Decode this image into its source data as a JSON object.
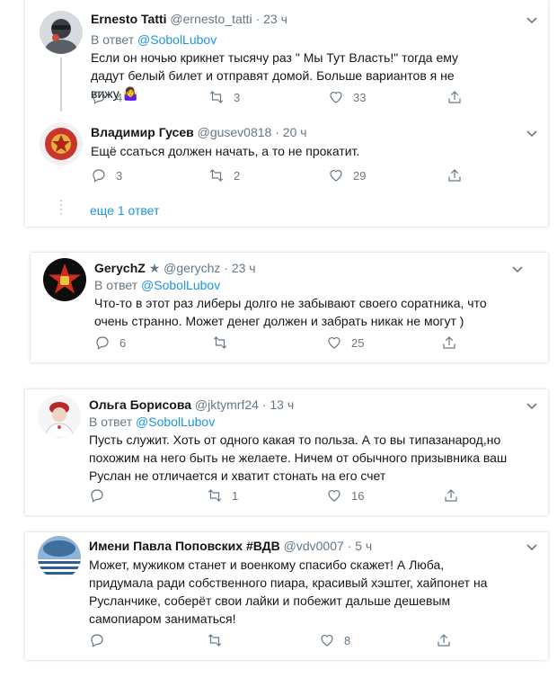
{
  "card1": {
    "tweet1": {
      "name": "Ernesto Tatti",
      "handle": "@ernesto_tatti",
      "dot": "·",
      "time": "23 ч",
      "reply_prefix": "В ответ",
      "reply_to": "@SobolLubov",
      "text": "Если он ночью крикнет тысячу раз \" Мы Тут Власть!\" тогда ему дадут белый билет и отправят домой. Больше вариантов я не вижу 🤷‍♀️",
      "replies": "4",
      "retweets": "3",
      "likes": "33"
    },
    "tweet2": {
      "name": "Владимир Гусев",
      "handle": "@gusev0818",
      "dot": "·",
      "time": "20 ч",
      "text": "Ещё ссаться должен начать, а то не прокатит.",
      "replies": "3",
      "retweets": "2",
      "likes": "29"
    },
    "more_replies": "еще 1 ответ"
  },
  "card2": {
    "name": "GerychZ",
    "star": "★",
    "handle": "@gerychz",
    "dot": "·",
    "time": "23 ч",
    "reply_prefix": "В ответ",
    "reply_to": "@SobolLubov",
    "text": "Что-то в этот раз либеры долго не забывают своего соратника, что очень странно. Может денег должен и забрать никак не могут )",
    "replies": "6",
    "retweets": "",
    "likes": "25"
  },
  "card3": {
    "name": "Ольга Борисова",
    "handle": "@jktymrf24",
    "dot": "·",
    "time": "13 ч",
    "reply_prefix": "В ответ",
    "reply_to": "@SobolLubov",
    "text": "Пусть служит. Хоть от одного какая то польза. А то вы типазанарод,но похожим на него быть не желаете. Ничем от обычного призывника ваш Руслан не отличается и хватит стонать на его счет",
    "replies": "",
    "retweets": "1",
    "likes": "16"
  },
  "card4": {
    "name": "Имени Павла Поповских #ВДВ",
    "handle": "@vdv0007",
    "dot": "·",
    "time": "5 ч",
    "text": "Может, мужиком станет и военкому спасибо скажет! А Люба, придумала ради собственного пиара, красивый хэштег, хайпонет на Русланчике, соберёт свои лайки и побежит дальше дешевым самопиаром заниматься!",
    "replies": "",
    "retweets": "",
    "likes": "8"
  },
  "colors": {
    "link": "#1b95e0",
    "muted": "#657786",
    "text": "#14171a",
    "thread": "#ccd6dd"
  }
}
